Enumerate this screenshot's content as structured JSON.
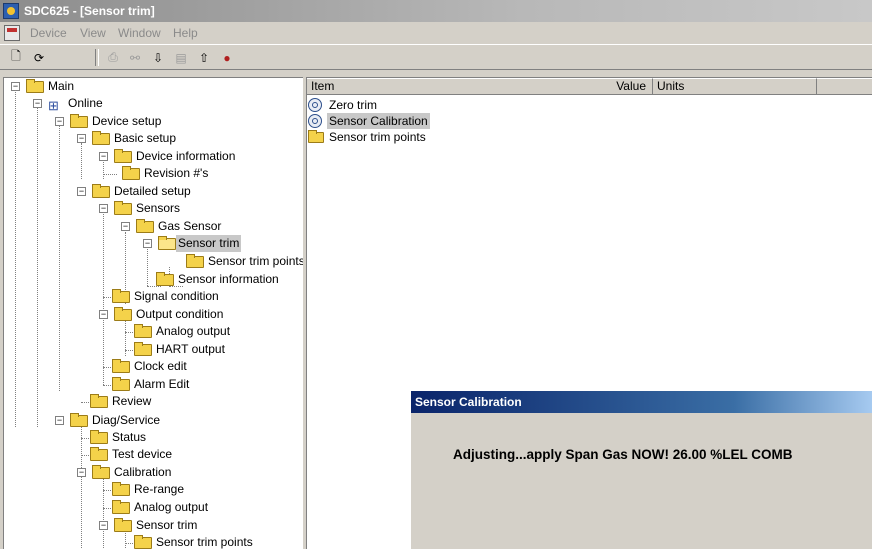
{
  "window": {
    "title": "SDC625 - [Sensor trim]"
  },
  "menu": {
    "items": [
      "Device",
      "View",
      "Window",
      "Help"
    ]
  },
  "toolbar": {
    "buttons": [
      "new-document-icon",
      "open-icon",
      "print-icon",
      "connect-icon",
      "load-icon",
      "save-icon",
      "export-icon",
      "stop-icon"
    ]
  },
  "tree": {
    "nodes": [
      {
        "label": "Main",
        "level": 0,
        "expanded": true,
        "icon": "folder"
      },
      {
        "label": "Online",
        "level": 1,
        "expanded": true,
        "icon": "network"
      },
      {
        "label": "Device setup",
        "level": 2,
        "expanded": true,
        "icon": "folder"
      },
      {
        "label": "Basic setup",
        "level": 3,
        "expanded": true,
        "icon": "folder"
      },
      {
        "label": "Device information",
        "level": 4,
        "expanded": true,
        "icon": "folder"
      },
      {
        "label": "Revision #'s",
        "level": 5,
        "icon": "folder"
      },
      {
        "label": "Detailed setup",
        "level": 3,
        "expanded": true,
        "icon": "folder"
      },
      {
        "label": "Sensors",
        "level": 4,
        "expanded": true,
        "icon": "folder"
      },
      {
        "label": "Gas Sensor",
        "level": 5,
        "expanded": true,
        "icon": "folder"
      },
      {
        "label": "Sensor trim",
        "level": 6,
        "expanded": true,
        "icon": "folder-open",
        "selected": true
      },
      {
        "label": "Sensor trim points",
        "level": 7,
        "icon": "folder"
      },
      {
        "label": "Sensor information",
        "level": 6,
        "icon": "folder"
      },
      {
        "label": "Signal condition",
        "level": 4,
        "icon": "folder"
      },
      {
        "label": "Output condition",
        "level": 4,
        "expanded": true,
        "icon": "folder"
      },
      {
        "label": "Analog output",
        "level": 5,
        "icon": "folder"
      },
      {
        "label": "HART output",
        "level": 5,
        "icon": "folder"
      },
      {
        "label": "Clock edit",
        "level": 4,
        "icon": "folder"
      },
      {
        "label": "Alarm Edit",
        "level": 4,
        "icon": "folder"
      },
      {
        "label": "Review",
        "level": 3,
        "icon": "folder"
      },
      {
        "label": "Diag/Service",
        "level": 2,
        "expanded": true,
        "icon": "folder"
      },
      {
        "label": "Status",
        "level": 3,
        "icon": "folder"
      },
      {
        "label": "Test device",
        "level": 3,
        "icon": "folder"
      },
      {
        "label": "Calibration",
        "level": 3,
        "expanded": true,
        "icon": "folder"
      },
      {
        "label": "Re-range",
        "level": 4,
        "icon": "folder"
      },
      {
        "label": "Analog output",
        "level": 4,
        "icon": "folder"
      },
      {
        "label": "Sensor trim",
        "level": 4,
        "expanded": true,
        "icon": "folder"
      },
      {
        "label": "Sensor trim points",
        "level": 5,
        "icon": "folder"
      }
    ]
  },
  "list": {
    "columns": [
      "Item",
      "Value",
      "Units"
    ],
    "rows": [
      {
        "item": "Zero trim",
        "icon": "method-icon"
      },
      {
        "item": "Sensor Calibration",
        "icon": "method-icon",
        "selected": true
      },
      {
        "item": "Sensor trim points",
        "icon": "folder-icon"
      }
    ]
  },
  "dialog": {
    "title": "Sensor Calibration",
    "message": "Adjusting...apply Span Gas NOW!  26.00 %LEL  COMB"
  }
}
